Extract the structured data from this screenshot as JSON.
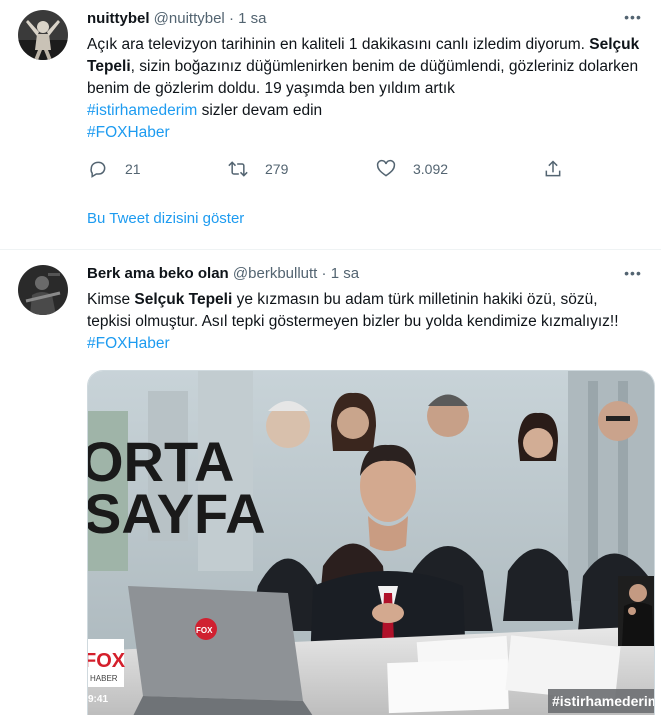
{
  "tweets": [
    {
      "display_name": "nuittybel",
      "handle": "@nuittybel",
      "separator": "·",
      "time": "1 sa",
      "more": "•••",
      "text": {
        "line1": "Açık ara televizyon tarihinin en kaliteli 1 dakikasını canlı izledim diyorum.",
        "name_bold": "Selçuk Tepeli",
        "line2_rest": ", sizin boğazınız düğümlenirken benim de düğümlendi, gözleriniz dolarken benim de gözlerim doldu. 19 yaşımda ben yıldım artık",
        "hashtag1": "#istirhamederim",
        "after_hashtag1": " sizler devam edin",
        "hashtag2": "#FOXHaber"
      },
      "actions": {
        "replies": "21",
        "retweets": "279",
        "likes": "3.092"
      },
      "thread_link": "Bu Tweet dizisini göster"
    },
    {
      "display_name": "Berk ama beko olan",
      "handle": "@berkbullutt",
      "separator": "·",
      "time": "1 sa",
      "more": "•••",
      "text": {
        "before_bold": "Kimse ",
        "name_bold": "Selçuk Tepeli",
        "after_bold": " ye kızmasın bu adam türk milletinin hakiki özü, sözü, tepkisi olmuştur. Asıl tepki göstermeyen bizler bu yolda kendimize kızmalıyız!! ",
        "hashtag": "#FOXHaber"
      },
      "media": {
        "show_title_line1": "ORTA",
        "show_title_line2": "SAYFA",
        "channel_logo": "FOX",
        "channel_sub": "HABER",
        "clock": "9:41",
        "hashtag_overlay": "#istirhamederim",
        "laptop_logo": "FOX"
      }
    }
  ],
  "colors": {
    "accent": "#1d9bf0",
    "secondary_text": "#536471",
    "text": "#0f1419",
    "divider": "#eff3f4"
  },
  "icons": [
    "reply-icon",
    "retweet-icon",
    "like-icon",
    "share-icon",
    "more-icon"
  ]
}
